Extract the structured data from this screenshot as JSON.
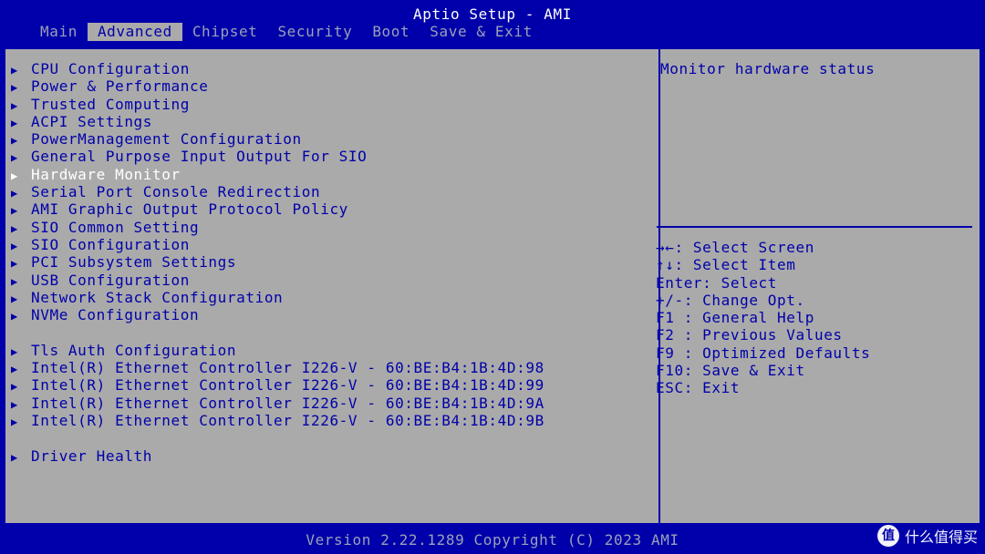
{
  "app": {
    "title": "Aptio Setup - AMI"
  },
  "tabs": [
    {
      "label": "Main",
      "active": false
    },
    {
      "label": "Advanced",
      "active": true
    },
    {
      "label": "Chipset",
      "active": false
    },
    {
      "label": "Security",
      "active": false
    },
    {
      "label": "Boot",
      "active": false
    },
    {
      "label": "Save & Exit",
      "active": false
    }
  ],
  "menu": {
    "arrow_icon": "triangle-right-icon",
    "items": [
      {
        "label": "CPU Configuration",
        "selected": false
      },
      {
        "label": "Power & Performance",
        "selected": false
      },
      {
        "label": "Trusted Computing",
        "selected": false
      },
      {
        "label": "ACPI Settings",
        "selected": false
      },
      {
        "label": "PowerManagement Configuration",
        "selected": false
      },
      {
        "label": "General Purpose Input Output For SIO",
        "selected": false
      },
      {
        "label": "Hardware Monitor",
        "selected": true
      },
      {
        "label": "Serial Port Console Redirection",
        "selected": false
      },
      {
        "label": "AMI Graphic Output Protocol Policy",
        "selected": false
      },
      {
        "label": "SIO Common Setting",
        "selected": false
      },
      {
        "label": "SIO Configuration",
        "selected": false
      },
      {
        "label": "PCI Subsystem Settings",
        "selected": false
      },
      {
        "label": "USB Configuration",
        "selected": false
      },
      {
        "label": "Network Stack Configuration",
        "selected": false
      },
      {
        "label": "NVMe Configuration",
        "selected": false
      },
      {
        "label": "",
        "selected": false
      },
      {
        "label": "Tls Auth Configuration",
        "selected": false
      },
      {
        "label": "Intel(R) Ethernet Controller I226-V - 60:BE:B4:1B:4D:98",
        "selected": false
      },
      {
        "label": "Intel(R) Ethernet Controller I226-V - 60:BE:B4:1B:4D:99",
        "selected": false
      },
      {
        "label": "Intel(R) Ethernet Controller I226-V - 60:BE:B4:1B:4D:9A",
        "selected": false
      },
      {
        "label": "Intel(R) Ethernet Controller I226-V - 60:BE:B4:1B:4D:9B",
        "selected": false
      },
      {
        "label": "",
        "selected": false
      },
      {
        "label": "Driver Health",
        "selected": false
      }
    ]
  },
  "help": {
    "text": "Monitor hardware status"
  },
  "keys": [
    "→←: Select Screen",
    "↑↓: Select Item",
    "Enter: Select",
    "+/-: Change Opt.",
    "F1 : General Help",
    "F2 : Previous Values",
    "F9 : Optimized Defaults",
    "F10: Save & Exit",
    "ESC: Exit"
  ],
  "footer": {
    "version": "Version 2.22.1289 Copyright (C) 2023 AMI"
  },
  "watermark": {
    "badge": "值",
    "text": "什么值得买"
  },
  "colors": {
    "background": "#0000aa",
    "panel": "#aaaaaa",
    "text": "#0000aa",
    "selected_text": "#ffffff",
    "inactive_tab": "#9aa0b8"
  }
}
